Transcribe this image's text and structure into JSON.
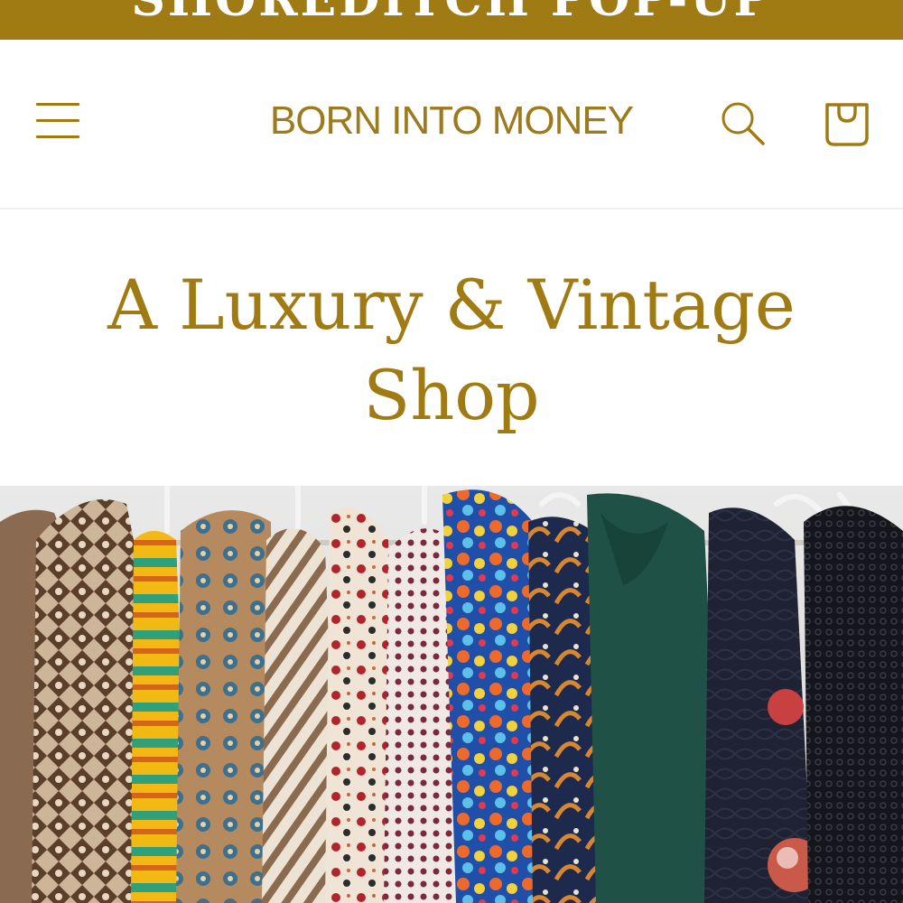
{
  "announcement": {
    "text": "SHOREDITCH POP-UP"
  },
  "header": {
    "menu_icon": "hamburger-menu-icon",
    "logo_text": "BORN INTO MONEY",
    "search_icon": "search-icon",
    "cart_icon": "cart-bag-icon"
  },
  "hero": {
    "title_line1": "A Luxury & Vintage",
    "title_line2": "Shop",
    "image_subject": "rack of vintage garments on white hangers"
  },
  "colors": {
    "accent": "#a07a12",
    "background": "#ffffff"
  }
}
